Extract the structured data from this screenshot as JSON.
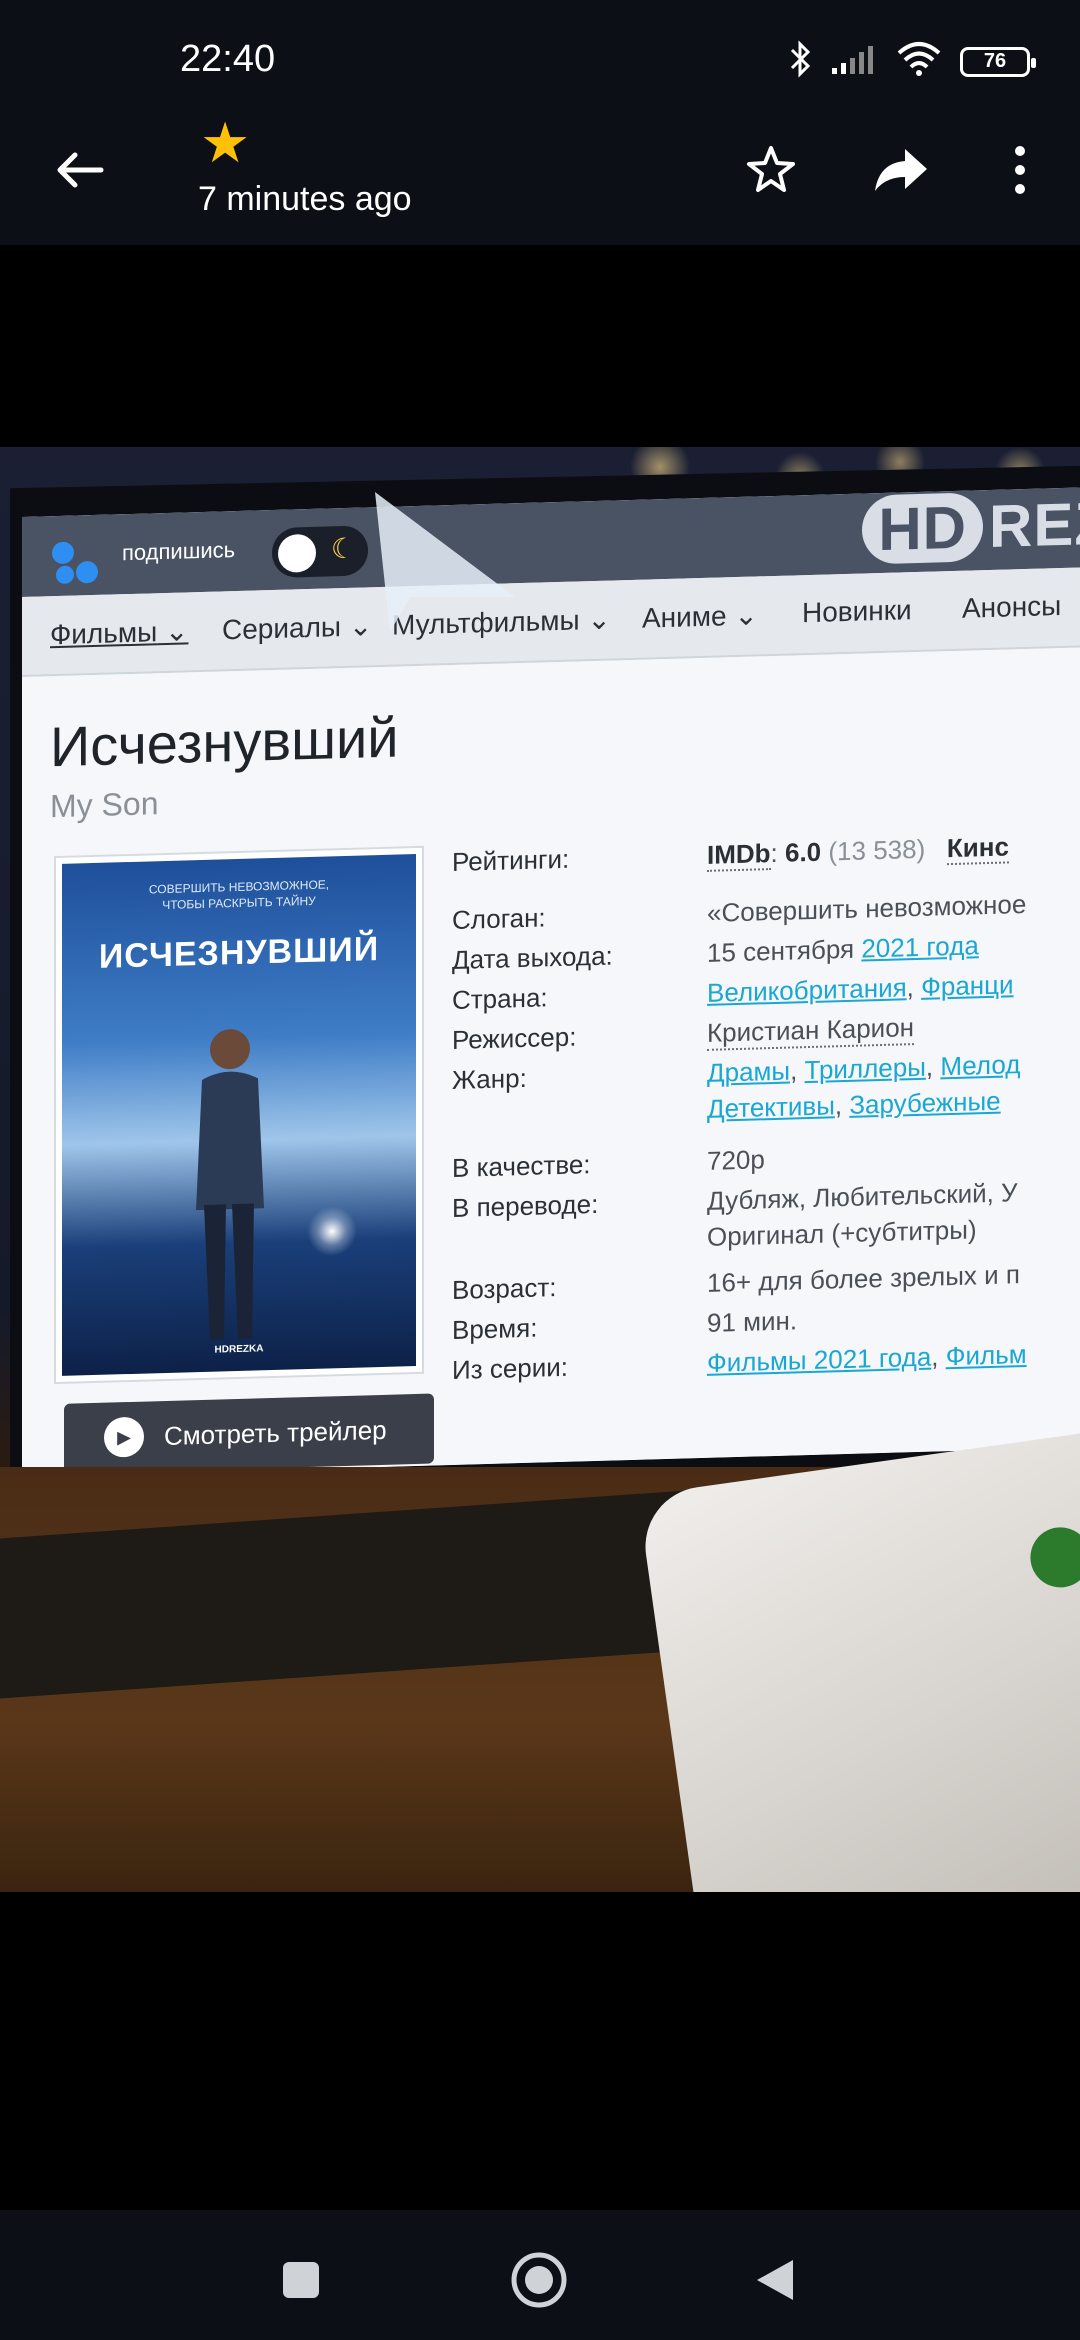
{
  "status_bar": {
    "time": "22:40",
    "battery": "76"
  },
  "app_bar": {
    "subtitle": "7 minutes ago"
  },
  "photo": {
    "site": {
      "subscribe_label": "подпишись",
      "logo_text_hd": "HD",
      "logo_text_rest": "REZ",
      "nav": [
        "Фильмы",
        "Сериалы",
        "Мультфильмы",
        "Аниме",
        "Новинки",
        "Анонсы"
      ],
      "title": "Исчезнувший",
      "original_title": "My Son",
      "poster": {
        "tagline_line1": "СОВЕРШИТЬ НЕВОЗМОЖНОЕ,",
        "tagline_line2": "ЧТОБЫ РАСКРЫТЬ ТАЙНУ",
        "title": "ИСЧЕЗНУВШИЙ",
        "logo": "HDREZKA"
      },
      "trailer_button": "Смотреть трейлер",
      "info": {
        "ratings_label": "Рейтинги:",
        "imdb_label": "IMDb",
        "imdb_score": "6.0",
        "imdb_votes": "(13 538)",
        "kinopoisk_label": "Кинс",
        "slogan_label": "Слоган:",
        "slogan_value": "«Совершить невозможное",
        "release_label": "Дата выхода:",
        "release_date": "15 сентября",
        "release_year": "2021 года",
        "country_label": "Страна:",
        "country_1": "Великобритания",
        "country_2": "Франци",
        "director_label": "Режиссер:",
        "director_value": "Кристиан Карион",
        "genre_label": "Жанр:",
        "genre_1": "Драмы",
        "genre_2": "Триллеры",
        "genre_3": "Мелод",
        "genre_4": "Детективы",
        "genre_5": "Зарубежные",
        "quality_label": "В качестве:",
        "quality_value": "720p",
        "translation_label": "В переводе:",
        "translation_line1": "Дубляж, Любительский, У",
        "translation_line2": "Оригинал (+субтитры)",
        "age_label": "Возраст:",
        "age_value": "16+ для более зрелых и п",
        "time_label": "Время:",
        "time_value": "91 мин.",
        "series_label": "Из серии:",
        "series_1": "Фильмы 2021 года",
        "series_2": "Фильм"
      }
    }
  },
  "colors": {
    "bar_bg": "#0c1016",
    "star": "#ffc107",
    "link": "#1aa7d4"
  },
  "icons": {
    "back": "arrow-left-icon",
    "favorite_badge": "star-filled-icon",
    "favorite": "star-outline-icon",
    "share": "share-icon",
    "more": "more-vertical-icon",
    "nav_recent": "square-icon",
    "nav_home": "circle-icon",
    "nav_back": "triangle-back-icon"
  }
}
